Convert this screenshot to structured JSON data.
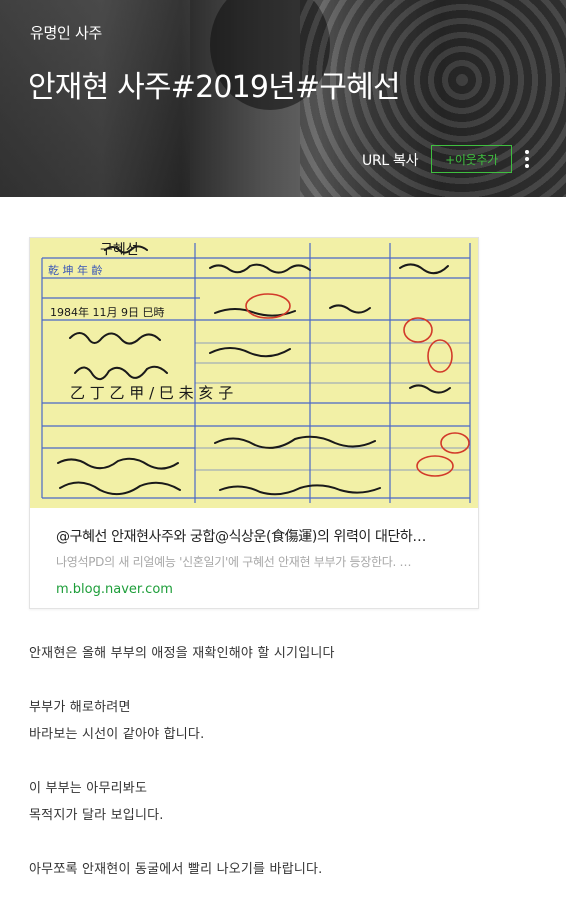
{
  "header": {
    "category": "유명인 사주",
    "title": "안재현 사주#2019년#구혜선",
    "url_copy_label": "URL 복사",
    "neighbor_label": "+이웃추가"
  },
  "link_card": {
    "title": "@구혜선 안재현사주와 궁합@식상운(食傷運)의 위력이 대단하…",
    "description": "나영석PD의 새 리얼예능 '신혼일기'에 구혜선 안재현 부부가 등장한다. …",
    "domain": "m.blog.naver.com",
    "image_text": {
      "name": "구혜선",
      "gender_age": "乾 坤 年 齡",
      "birth": "1984年 11月 9日 巳時",
      "pillars": "乙 丁 乙 甲 / 巳 未 亥 子"
    }
  },
  "post_body": [
    "안재현은  올해  부부의  애정을  재확인해야  할  시기입니다",
    "",
    "부부가  해로하려면",
    "바라보는  시선이  같아야  합니다.",
    "",
    "이  부부는  아무리봐도",
    "목적지가  달라  보입니다.",
    "",
    "아무쪼록  안재현이  동굴에서  빨리  나오기를  바랍니다."
  ]
}
